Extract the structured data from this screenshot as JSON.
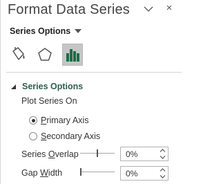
{
  "pane": {
    "title": "Format Data Series",
    "close_glyph": "×"
  },
  "options_menu": {
    "label": "Series Options"
  },
  "tabs": [
    {
      "name": "Fill & Line",
      "icon": "paint-bucket-icon"
    },
    {
      "name": "Effects",
      "icon": "pentagon-icon"
    },
    {
      "name": "Series Options",
      "icon": "bar-chart-icon",
      "selected": true
    }
  ],
  "section": {
    "title": "Series Options",
    "plot_series_on_label": "Plot Series On",
    "radios": {
      "primary": {
        "hotkey": "P",
        "rest": "rimary Axis",
        "checked": true
      },
      "secondary": {
        "hotkey": "S",
        "rest": "econdary Axis",
        "checked": false
      }
    },
    "series_overlap": {
      "label_before": "Series ",
      "hotkey": "O",
      "label_after": "verlap",
      "value": "0%",
      "slider_fraction": 0.5
    },
    "gap_width": {
      "label_before": "Gap ",
      "hotkey": "W",
      "label_after": "idth",
      "value": "0%",
      "slider_fraction": 0.0
    }
  },
  "colors": {
    "accent_green": "#2f5f4a",
    "selected_tab_bg": "#c6c6c6",
    "bar_icon_green": "#1f6b45"
  }
}
